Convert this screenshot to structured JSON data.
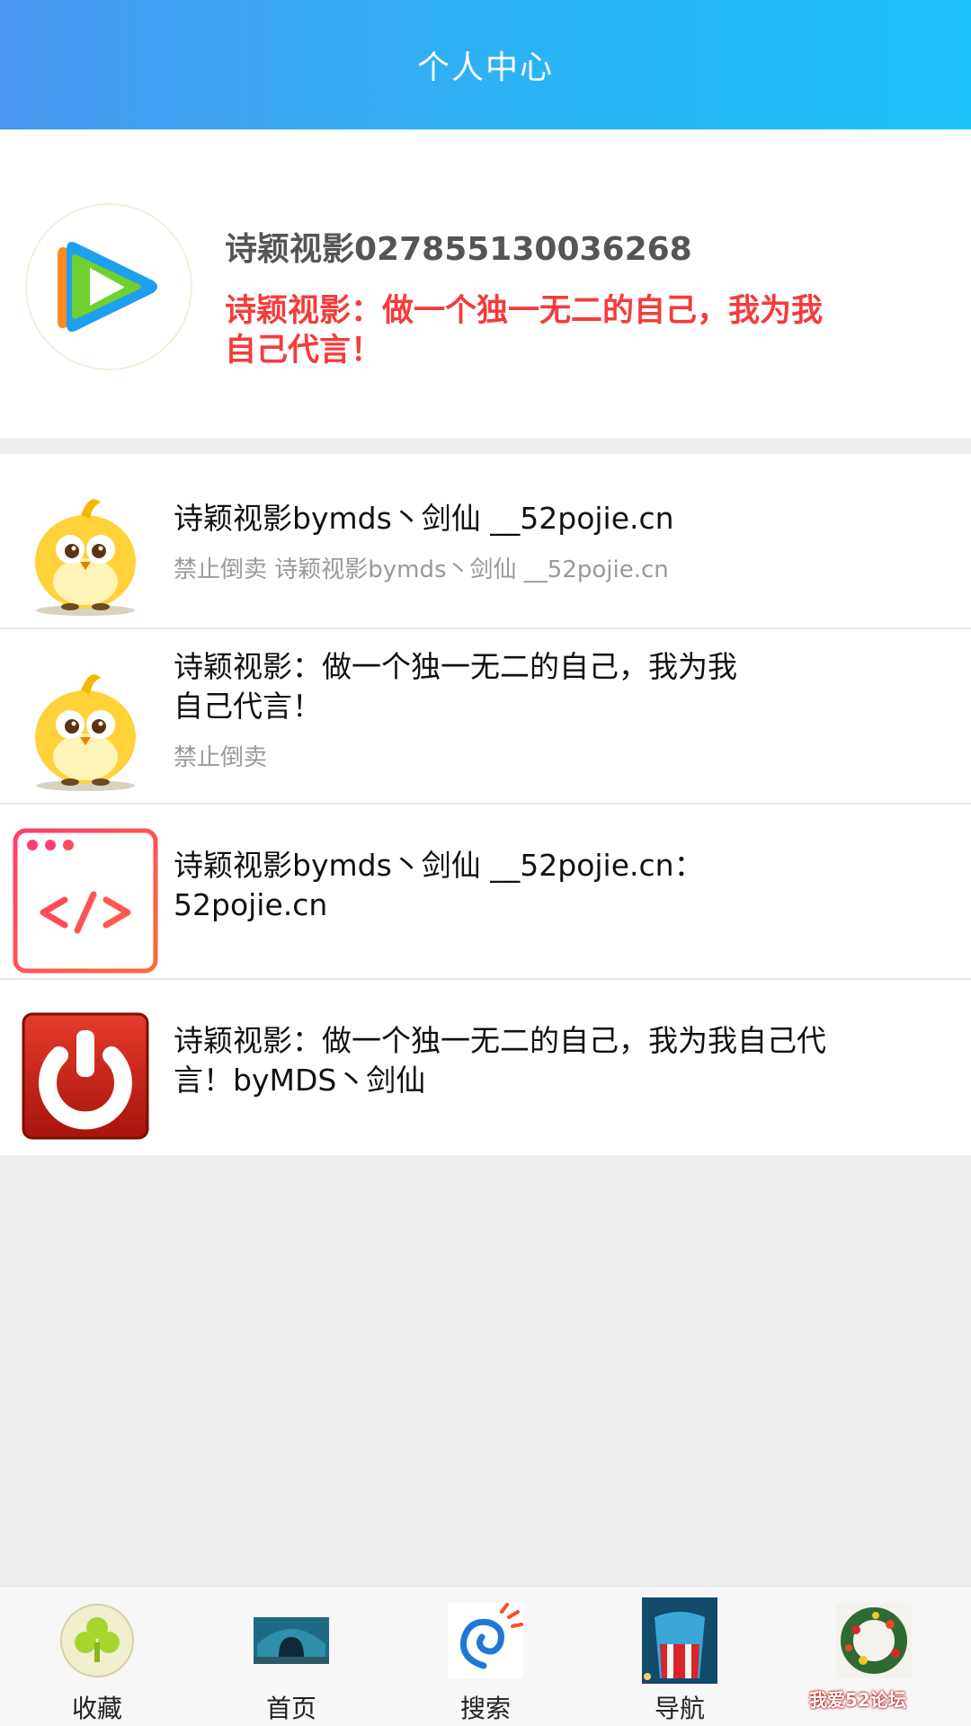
{
  "header": {
    "title": "个人中心"
  },
  "profile": {
    "name": "诗颖视影027855130036268",
    "motto": "诗颖视影：做一个独一无二的自己，我为我自己代言！"
  },
  "items": [
    {
      "title": "诗颖视影bymds丶剑仙 __52pojie.cn",
      "subtitle": "禁止倒卖 诗颖视影bymds丶剑仙 __52pojie.cn",
      "icon": "chick-icon"
    },
    {
      "title": "诗颖视影：做一个独一无二的自己，我为我自己代言！",
      "subtitle": "禁止倒卖",
      "icon": "chick-icon"
    },
    {
      "title": "诗颖视影bymds丶剑仙 __52pojie.cn：52pojie.cn",
      "subtitle": "",
      "icon": "code-window-icon"
    },
    {
      "title": "诗颖视影：做一个独一无二的自己，我为我自己代言！byMDS丶剑仙",
      "subtitle": "",
      "icon": "power-icon"
    }
  ],
  "tabbar": {
    "tabs": [
      {
        "label": "收藏",
        "icon": "clover-icon"
      },
      {
        "label": "首页",
        "icon": "tunnel-icon"
      },
      {
        "label": "搜索",
        "icon": "swirl-icon"
      },
      {
        "label": "导航",
        "icon": "popcorn-icon"
      },
      {
        "label": "",
        "icon": "wreath-icon"
      }
    ]
  },
  "watermark": {
    "text": "我爱52论坛"
  },
  "colors": {
    "header_start": "#4a96f0",
    "header_end": "#1ec2fb",
    "motto": "#f53b3b",
    "subtitle": "#999999"
  }
}
